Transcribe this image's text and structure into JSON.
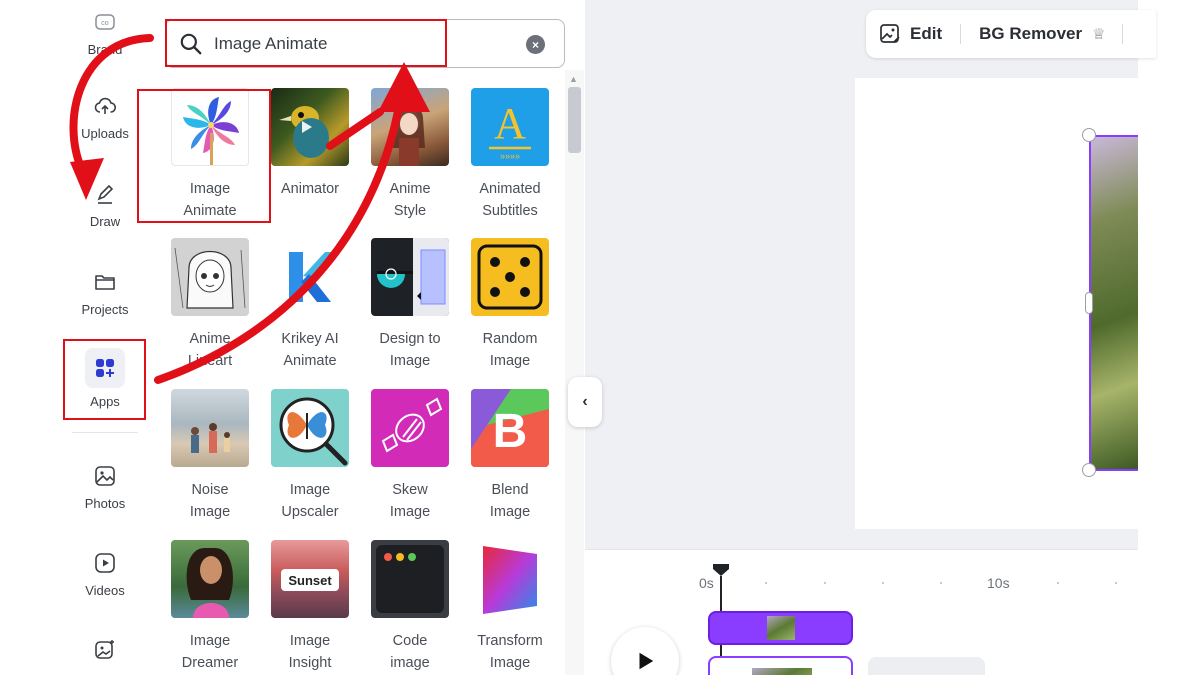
{
  "rail": {
    "items": [
      {
        "label": "Brand",
        "icon": "brand-icon"
      },
      {
        "label": "Uploads",
        "icon": "cloud-upload-icon"
      },
      {
        "label": "Draw",
        "icon": "pen-icon"
      },
      {
        "label": "Projects",
        "icon": "folder-icon"
      },
      {
        "label": "Apps",
        "icon": "apps-grid-icon"
      },
      {
        "label": "Photos",
        "icon": "photo-icon"
      },
      {
        "label": "Videos",
        "icon": "video-icon"
      },
      {
        "label": "",
        "icon": "magic-image-icon"
      }
    ]
  },
  "search": {
    "value": "Image Animate",
    "icon": "search-icon"
  },
  "apps": [
    {
      "line1": "Image",
      "line2": "Animate"
    },
    {
      "line1": "Animator",
      "line2": ""
    },
    {
      "line1": "Anime",
      "line2": "Style"
    },
    {
      "line1": "Animated",
      "line2": "Subtitles"
    },
    {
      "line1": "Anime",
      "line2": "Lineart"
    },
    {
      "line1": "Krikey AI",
      "line2": "Animate"
    },
    {
      "line1": "Design to",
      "line2": "Image"
    },
    {
      "line1": "Random",
      "line2": "Image"
    },
    {
      "line1": "Noise",
      "line2": "Image"
    },
    {
      "line1": "Image",
      "line2": "Upscaler"
    },
    {
      "line1": "Skew",
      "line2": "Image"
    },
    {
      "line1": "Blend",
      "line2": "Image"
    },
    {
      "line1": "Image",
      "line2": "Dreamer"
    },
    {
      "line1": "Image",
      "line2": "Insight"
    },
    {
      "line1": "Code",
      "line2": "image"
    },
    {
      "line1": "Transform",
      "line2": "Image"
    }
  ],
  "thumb_text": {
    "sunset": "Sunset",
    "anime_style_a": "A"
  },
  "toolbar": {
    "edit_label": "Edit",
    "bg_remover_label": "BG Remover"
  },
  "timeline": {
    "tick_0": "0s",
    "tick_10": "10s"
  },
  "colors": {
    "accent": "#8b3dff",
    "annotation": "#e10f17"
  }
}
